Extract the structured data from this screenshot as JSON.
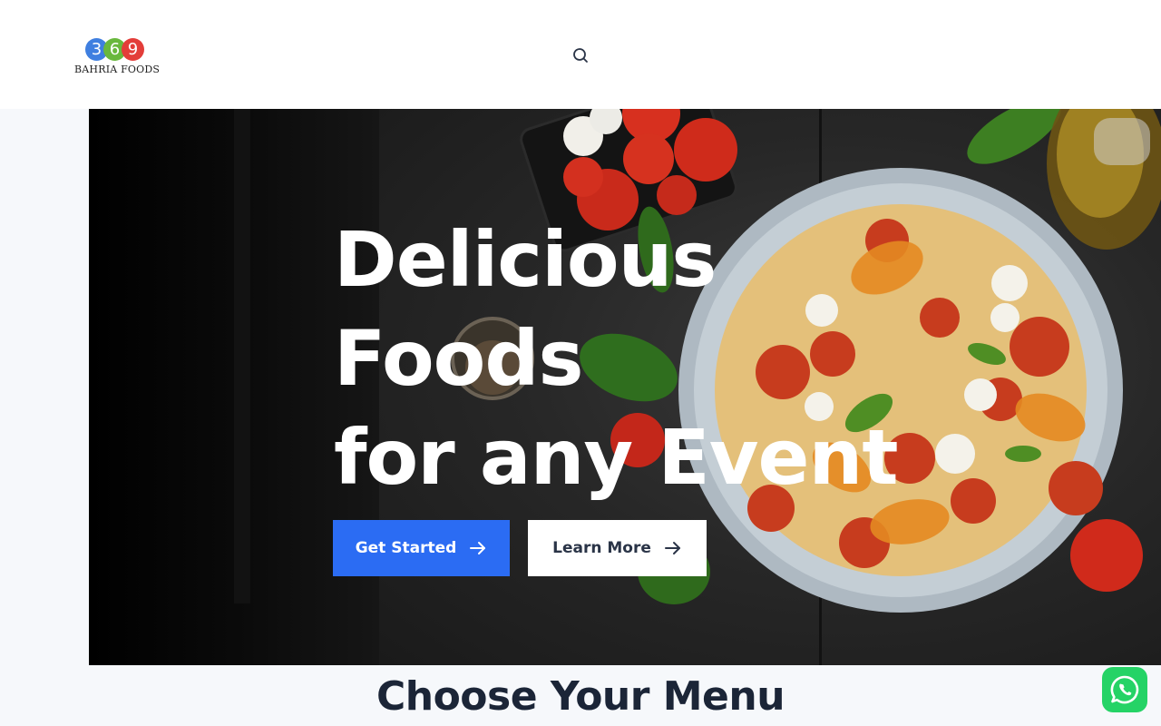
{
  "header": {
    "logo": {
      "digits": [
        "3",
        "6",
        "9"
      ],
      "name": "BAHRIA FOODS"
    },
    "search_icon": "search-icon"
  },
  "hero": {
    "title_lines": [
      "Delicious",
      "Foods",
      "for any Event"
    ],
    "primary_button": "Get Started",
    "secondary_button": "Learn More",
    "button_icon": "arrow-right-icon"
  },
  "section": {
    "title": "Choose Your Menu"
  },
  "floating": {
    "whatsapp_icon": "whatsapp-icon"
  },
  "colors": {
    "primary": "#2b6cf3",
    "heading": "#1b2537",
    "whatsapp": "#25d366",
    "logo": [
      "#3f7fe0",
      "#69b83d",
      "#e33d39"
    ]
  }
}
